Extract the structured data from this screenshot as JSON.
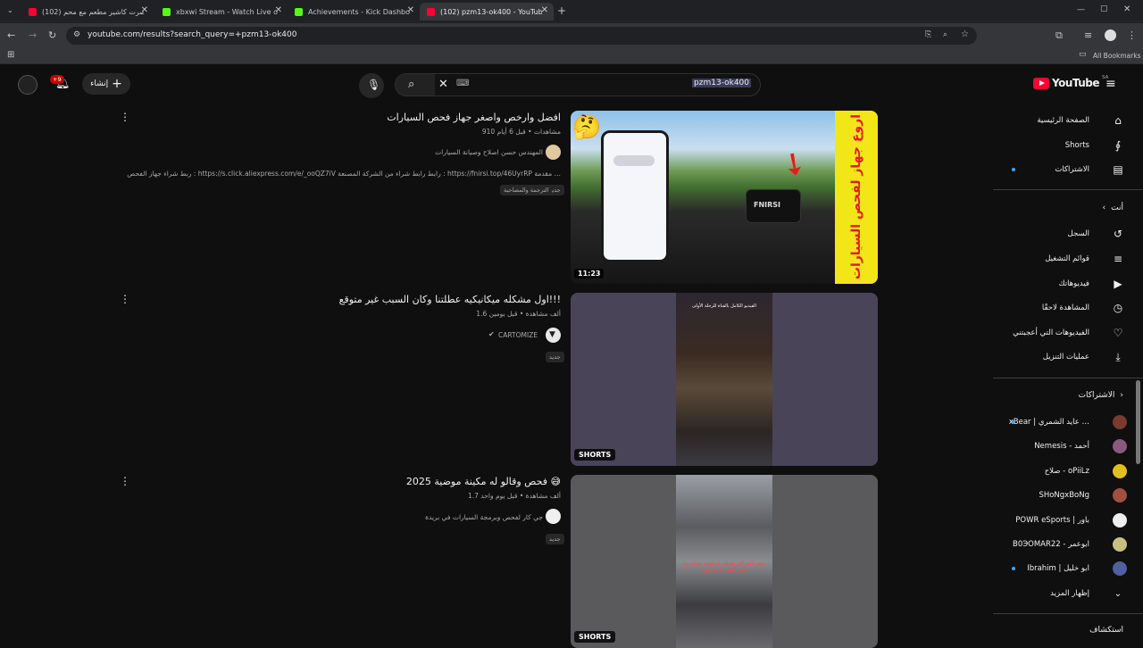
{
  "browser": {
    "tabs": [
      {
        "title": "(102) صرت كاشير مطعم مع محم…",
        "color": "#ff0033"
      },
      {
        "title": "xbxwi Stream - Watch Live on K…",
        "color": "#53fc18"
      },
      {
        "title": "Achievements - Kick Dashboard",
        "color": "#53fc18"
      },
      {
        "title": "(102) pzm13-ok400 - YouTube",
        "color": "#ff0033"
      }
    ],
    "url": "youtube.com/results?search_query=+pzm13-ok400",
    "bookmarks_label": "All Bookmarks"
  },
  "header": {
    "logo_text": "YouTube",
    "region": "SA",
    "search_value": "pzm13-ok400",
    "create_label": "إنشاء",
    "notif_count": "+9"
  },
  "sidebar": {
    "main": [
      {
        "label": "الصفحة الرئيسية",
        "icon": "home-icon",
        "glyph": "⌂"
      },
      {
        "label": "Shorts",
        "icon": "shorts-icon",
        "glyph": "∮"
      },
      {
        "label": "الاشتراكات",
        "icon": "subscriptions-icon",
        "glyph": "▤"
      }
    ],
    "you_title": "أنت",
    "you": [
      {
        "label": "السجل",
        "icon": "history-icon",
        "glyph": "↺"
      },
      {
        "label": "قوائم التشغيل",
        "icon": "playlists-icon",
        "glyph": "≡"
      },
      {
        "label": "فيديوهاتك",
        "icon": "your-videos-icon",
        "glyph": "▶"
      },
      {
        "label": "المشاهدة لاحقًا",
        "icon": "watch-later-icon",
        "glyph": "◷"
      },
      {
        "label": "الفيديوهات التي أعجبتني",
        "icon": "like-icon",
        "glyph": "👍"
      },
      {
        "label": "عمليات التنزيل",
        "icon": "download-icon",
        "glyph": "⤓"
      }
    ],
    "subs_title": "الاشتراكات",
    "subs": [
      {
        "label": "xBear | عايد الشمري …",
        "color": "#7a3b2e",
        "live": true
      },
      {
        "label": "Nemesis - أحمد",
        "color": "#8a5a7a",
        "live": false
      },
      {
        "label": "صلاح - oPiiLz",
        "color": "#e0c020",
        "live": false
      },
      {
        "label": "SHoNgxBoNg",
        "color": "#a05040",
        "live": false
      },
      {
        "label": "POWR eSports | باور",
        "color": "#eeeeee",
        "live": false
      },
      {
        "label": "B0ЭOMAR22 - ابوعمر",
        "color": "#c8c080",
        "live": false
      },
      {
        "label": "Ibrahim | ابو خليل",
        "color": "#5060a0",
        "live": true
      }
    ],
    "show_more": "إظهار المزيد",
    "explore_title": "استكشاف"
  },
  "results": [
    {
      "title": "افضل وارخص واصغر جهاز فحص السيارات",
      "meta": "910 مشاهدات • قبل 6 أيام",
      "channel": "المهندس حسن اصلاح وصيانة السيارات",
      "desc": "ربط شراء جهاز الفحص : https://s.click.aliexpress.com/e/_ooQZ7iV رابط رابط شراء من الشركة المصنعة : https://fnirsi.top/46UyrRP مقدمة …",
      "chips": [
        "جديد",
        "الترجمة والمصاحبة"
      ],
      "badge": "11:23",
      "thumb_text": "اروع جهاز لفحص السيارات",
      "brand": "FNIRSI"
    },
    {
      "title": "اول مشكله ميكانيكيه عطلتنا وكان السبب غير متوقع!!!",
      "meta": "1.6 ألف مشاهدة • قبل يومين",
      "channel": "CARTOMIZE",
      "chips": [
        "جديد"
      ],
      "badge": "SHORTS",
      "thumb_text": "الفيديو الكامل بالقناة للرحلة الأولى"
    },
    {
      "title": "2025 فحص وقالو له مكينة موضية 😅",
      "meta": "1.7 ألف مشاهدة • قبل يوم واحد",
      "channel": "جي كار لفحص وبرمجة السيارات في بريدة",
      "chips": [
        "جديد"
      ],
      "badge": "SHORTS",
      "thumb_text": "بعض المراكز يقولك الماكينة تعبانة ولا همه لأنهم ما يعرفون"
    }
  ]
}
